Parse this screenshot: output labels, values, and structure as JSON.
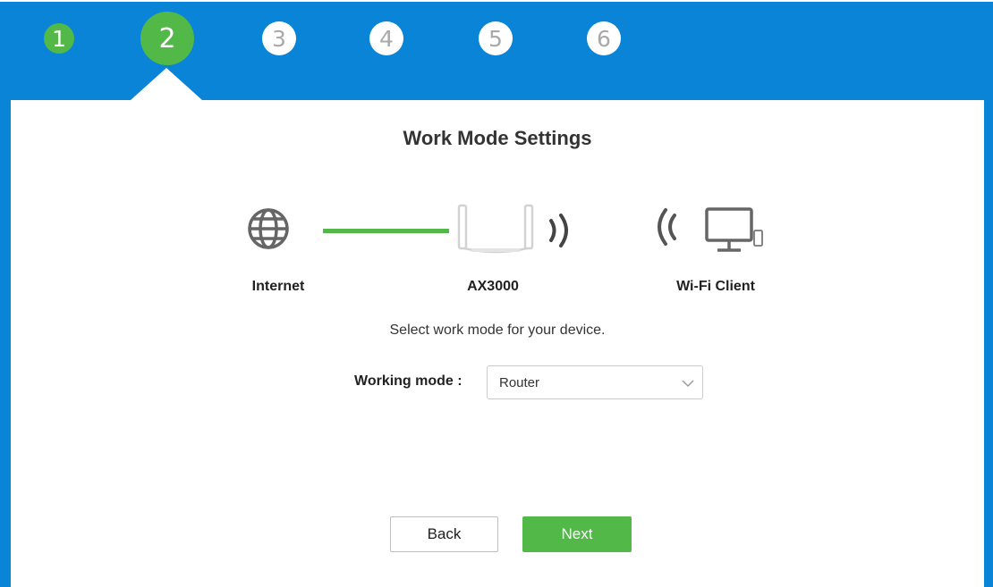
{
  "steps": {
    "items": [
      {
        "num": "1",
        "state": "done"
      },
      {
        "num": "2",
        "state": "current"
      },
      {
        "num": "3",
        "state": "todo"
      },
      {
        "num": "4",
        "state": "todo"
      },
      {
        "num": "5",
        "state": "todo"
      },
      {
        "num": "6",
        "state": "todo"
      }
    ]
  },
  "page": {
    "title": "Work Mode Settings",
    "subtitle": "Select work mode for your device."
  },
  "diagram": {
    "internet_label": "Internet",
    "router_label": "AX3000",
    "client_label": "Wi-Fi Client",
    "icons": [
      "globe-icon",
      "router-icon",
      "wifi-signal-icon",
      "monitor-phone-icon"
    ]
  },
  "form": {
    "mode_label": "Working mode :",
    "mode_value": "Router"
  },
  "buttons": {
    "back": "Back",
    "next": "Next"
  },
  "colors": {
    "header_blue": "#0a84d6",
    "accent_green": "#52b848",
    "icon_gray": "#666666"
  }
}
